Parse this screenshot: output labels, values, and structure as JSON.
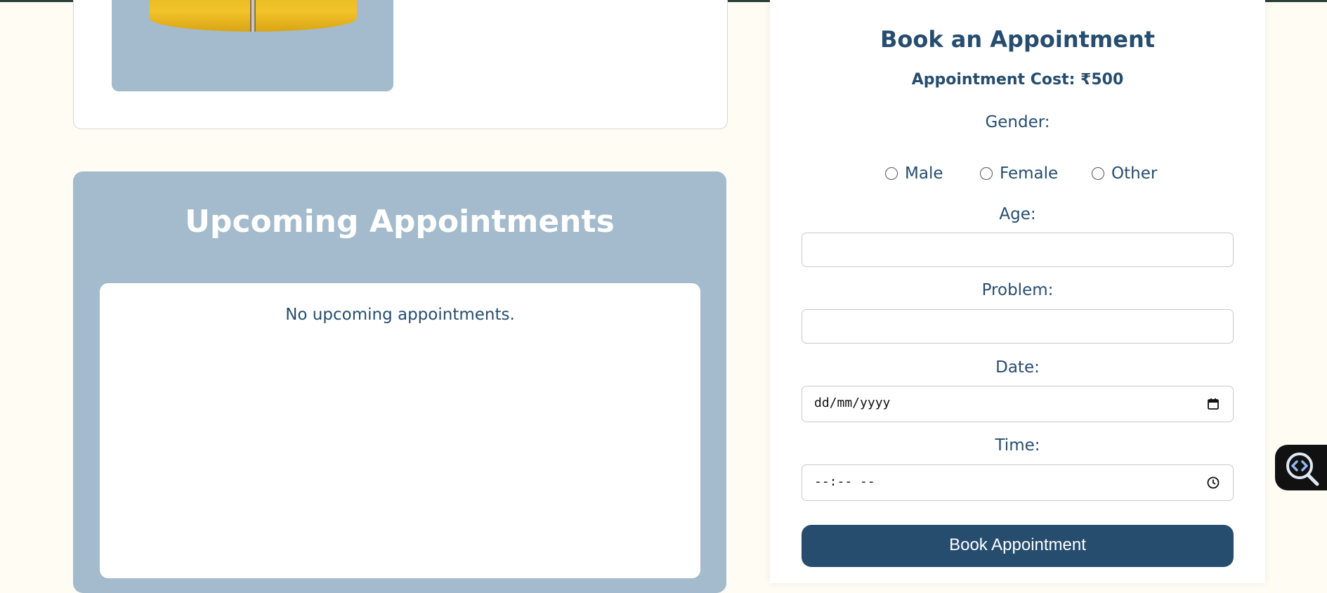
{
  "upcoming": {
    "title": "Upcoming Appointments",
    "empty_message": "No upcoming appointments."
  },
  "booking": {
    "title": "Book an Appointment",
    "cost_label": "Appointment Cost: ₹500",
    "gender_label": "Gender:",
    "gender_options": [
      "Male",
      "Female",
      "Other"
    ],
    "age_label": "Age:",
    "age_value": "",
    "problem_label": "Problem:",
    "problem_value": "",
    "date_label": "Date:",
    "date_placeholder": "dd/mm/yyyy",
    "time_label": "Time:",
    "time_placeholder": "--:-- --",
    "submit_label": "Book Appointment"
  },
  "icons": {
    "calendar": "calendar-icon",
    "clock": "clock-icon",
    "floating_tool": "code-search-icon"
  },
  "colors": {
    "primary": "#264d6e",
    "card_blue": "#a3bbcc",
    "page_bg": "#fffcf3"
  }
}
